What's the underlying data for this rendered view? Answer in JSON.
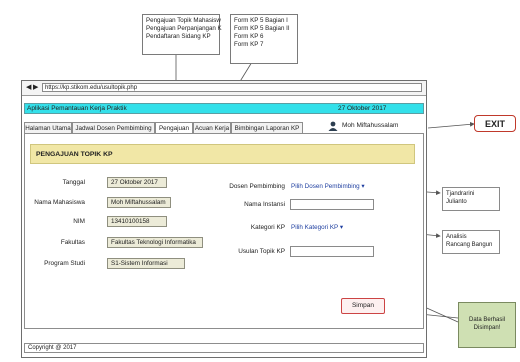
{
  "callouts": {
    "pengajuan_menu": [
      "Pengajuan Topik Mahasisw",
      "Pengajuan Perpanjangan K",
      "Pendaftaran Sidang KP"
    ],
    "acuan_menu": [
      "Form KP 5 Bagian I",
      "Form KP 5 Bagian II",
      "Form KP 6",
      "Form KP 7"
    ],
    "dosen_options": [
      "Tjandrarini",
      "Julianto"
    ],
    "kategori_options": [
      "Analisis",
      "Rancang Bangun"
    ],
    "exit_label": "EXIT",
    "success_note": [
      "Data Berhasil",
      "Disimpan!"
    ]
  },
  "browser": {
    "url": "https://kp.stikom.edu/usultopik.php",
    "back_glyph": "◀",
    "forward_glyph": "▶"
  },
  "app": {
    "title": "Aplikasi Pemantauan Kerja Praktik",
    "date": "27 Oktober 2017",
    "user": "Moh Miftahussalam",
    "user_icon": "user-icon",
    "tabs": [
      "Halaman Utama",
      "Jadwal Dosen Pembimbing",
      "Pengajuan",
      "Acuan Kerja",
      "Bimbingan Laporan KP"
    ],
    "active_tab": "Pengajuan"
  },
  "form": {
    "heading": "PENGAJUAN TOPIK KP",
    "tanggal_label": "Tanggal",
    "tanggal_value": "27 Oktober 2017",
    "nama_label": "Nama Mahasiswa",
    "nama_value": "Moh Miftahussalam",
    "nim_label": "NIM",
    "nim_value": "13410100158",
    "fakultas_label": "Fakultas",
    "fakultas_value": "Fakultas Teknologi Informatika",
    "prodi_label": "Program Studi",
    "prodi_value": "S1-Sistem Informasi",
    "dosen_label": "Dosen Pembimbing",
    "dosen_placeholder": "Pilih Dosen Pembimbing",
    "instansi_label": "Nama Instansi",
    "kategori_label": "Kategori KP",
    "kategori_placeholder": "Pilih Kategori KP",
    "usulan_label": "Usulan Topik KP",
    "submit_label": "Simpan",
    "dropdown_glyph": "▾"
  },
  "footer": {
    "copyright": "Copyright @ 2017"
  }
}
